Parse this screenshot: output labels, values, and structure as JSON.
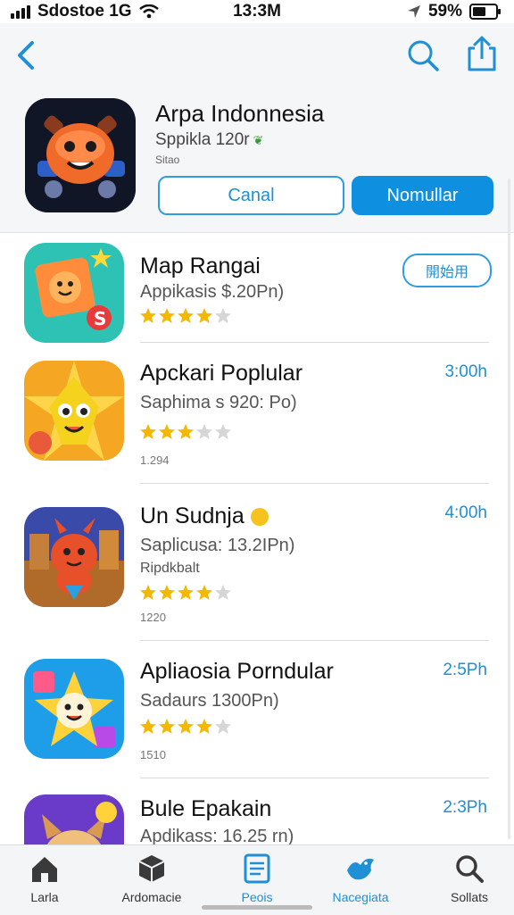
{
  "status_bar": {
    "carrier": "Sdostoe 1G",
    "time": "13:3M",
    "battery": "59%"
  },
  "header": {
    "app_title": "Arpa Indonnesia",
    "app_subtitle": "Sppikla 120r",
    "app_meta": "Sitao",
    "button_outline": "Canal",
    "button_solid": "Nomullar"
  },
  "apps": [
    {
      "title": "Map Rangai",
      "subtitle": "Appikasis $.20Pn)",
      "rating": 4,
      "action_label": "開始用"
    },
    {
      "title": "Apckari Poplular",
      "subtitle": "Saphima s 920: Po)",
      "rating": 3,
      "count": "1.294",
      "time": "3:00h"
    },
    {
      "title": "Un Sudnja",
      "subtitle": "Saplicusa: 13.2IPn)",
      "extra": "Ripdkbalt",
      "rating": 4,
      "count": "1220",
      "time": "4:00h"
    },
    {
      "title": "Apliaosia Porndular",
      "subtitle": "Sadaurs 1300Pn)",
      "rating": 4,
      "count": "1510",
      "time": "2:5Ph"
    },
    {
      "title": "Bule Epakain",
      "subtitle": "Apdikass: 16.25 rn)",
      "time": "2:3Ph"
    }
  ],
  "tabs": [
    {
      "label": "Larla",
      "icon": "home-icon"
    },
    {
      "label": "Ardomacie",
      "icon": "box-icon"
    },
    {
      "label": "Peois",
      "icon": "document-icon"
    },
    {
      "label": "Nacegiata",
      "icon": "bird-icon"
    },
    {
      "label": "Sollats",
      "icon": "search-icon"
    }
  ],
  "colors": {
    "accent": "#1f8fd6",
    "star": "#f5b800",
    "star_empty": "#d6d6d6"
  }
}
